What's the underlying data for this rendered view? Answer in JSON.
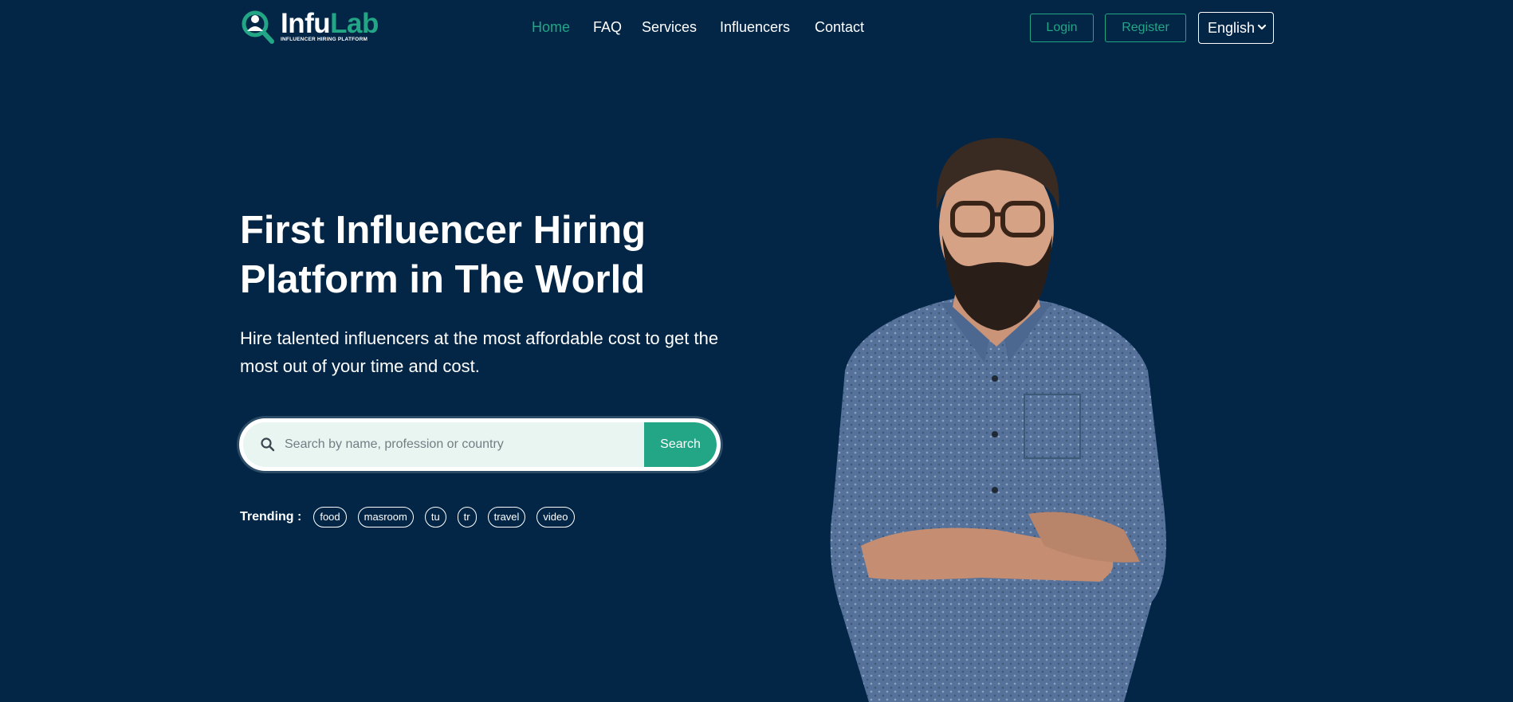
{
  "brand": {
    "name_part_1": "Infu",
    "name_part_2": "Lab",
    "tagline": "INFLUENCER HIRING PLATFORM",
    "icon": "magnifier-person-logo",
    "color_primary": "#22a685",
    "color_background": "#032646"
  },
  "nav": {
    "items": [
      {
        "label": "Home",
        "active": true
      },
      {
        "label": "FAQ",
        "active": false
      },
      {
        "label": "Services",
        "active": false
      },
      {
        "label": "Influencers",
        "active": false
      },
      {
        "label": "Contact",
        "active": false
      }
    ]
  },
  "auth": {
    "login_label": "Login",
    "register_label": "Register"
  },
  "language": {
    "selected": "English",
    "icon": "chevron-down-icon"
  },
  "hero": {
    "title": "First Influencer Hiring Platform in The World",
    "subtitle": "Hire talented influencers at the most affordable cost to get the most out of your time and cost."
  },
  "search": {
    "icon": "search-icon",
    "placeholder": "Search by name, profession or country",
    "value": "",
    "button_label": "Search"
  },
  "trending": {
    "label": "Trending :",
    "tags": [
      "food",
      "masroom",
      "tu",
      "tr",
      "travel",
      "video"
    ]
  },
  "hero_image": {
    "subject": "bearded man with glasses in blue patterned shirt, arms crossed"
  }
}
